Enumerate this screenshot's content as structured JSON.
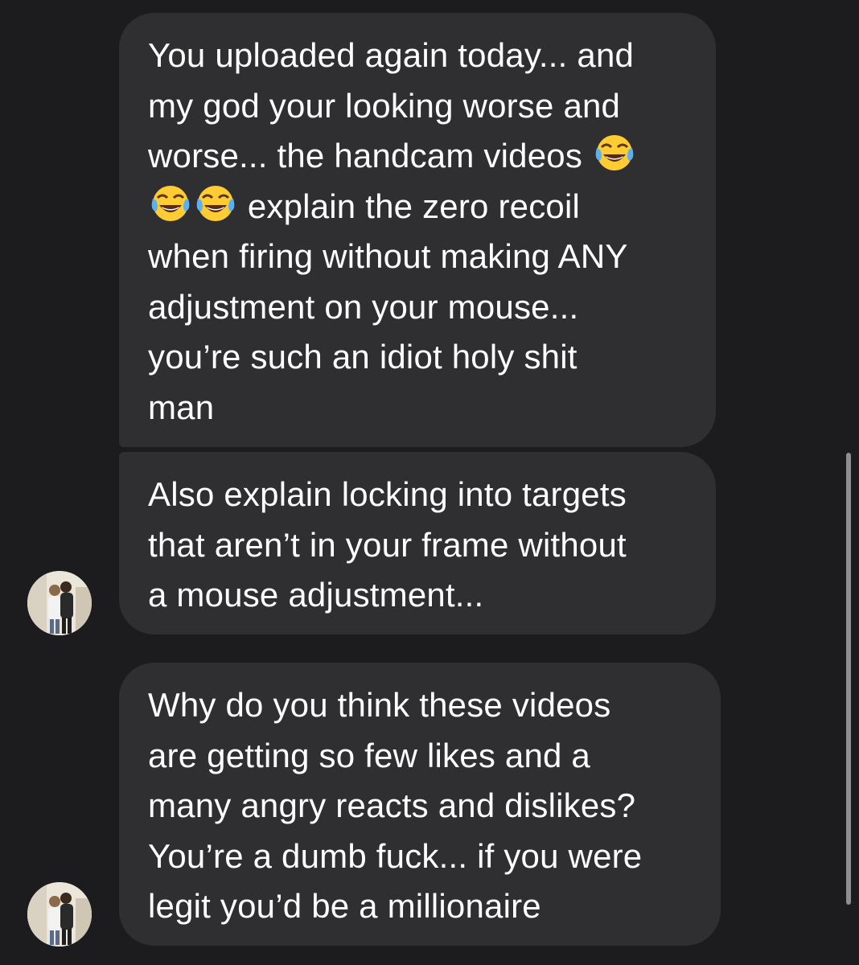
{
  "messages": [
    {
      "text_before_emoji": "You uploaded again today... and\nmy god your looking worse and\nworse... the handcam videos ",
      "text_mid": "\n",
      "text_after_emoji": " explain the zero recoil\nwhen firing without making ANY\nadjustment on your mouse...\nyou’re such an idiot holy shit\nman",
      "emoji": "face-with-tears-of-joy-icon"
    },
    {
      "text": "Also explain locking into targets\nthat aren’t in your frame without\na mouse adjustment..."
    },
    {
      "text": "Why do you think these videos\nare getting so few likes and a\nmany angry reacts and dislikes?\nYou’re a dumb fuck... if you were\nlegit you’d be a millionaire"
    }
  ],
  "colors": {
    "background": "#1c1c1e",
    "bubble": "#2f2f31",
    "text": "#ffffff",
    "scrollbar": "#8e8e93"
  }
}
